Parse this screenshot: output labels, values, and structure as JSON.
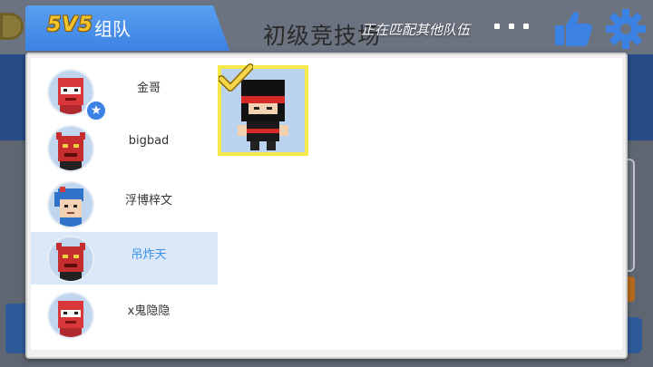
{
  "header": {
    "mode": "5V5",
    "label": "组队",
    "arena_title": "初级竞技场",
    "status": "正在匹配其他队伍"
  },
  "top_right": {
    "icons": [
      "thumbs-up-icon",
      "gear-icon"
    ]
  },
  "team": {
    "members": [
      {
        "name": "金哥",
        "leader": true,
        "selected": false,
        "avatar": "red-block-avatar"
      },
      {
        "name": "bigbad",
        "leader": false,
        "selected": false,
        "avatar": "red-devil-avatar"
      },
      {
        "name": "浮博梓文",
        "leader": false,
        "selected": false,
        "avatar": "blue-hair-avatar"
      },
      {
        "name": "吊炸天",
        "leader": false,
        "selected": true,
        "avatar": "red-devil-avatar"
      },
      {
        "name": "x鬼隐隐",
        "leader": false,
        "selected": false,
        "avatar": "red-block-avatar"
      }
    ]
  },
  "ready_card": {
    "character": "ninja-character",
    "status_icon": "checkmark-icon"
  },
  "colors": {
    "tab_blue": "#3b82e4",
    "selected_bg": "#dae8f9",
    "selected_text": "#3a8ee8",
    "ready_frame": "#f5e94a",
    "mode_gold": "#f4c430"
  }
}
